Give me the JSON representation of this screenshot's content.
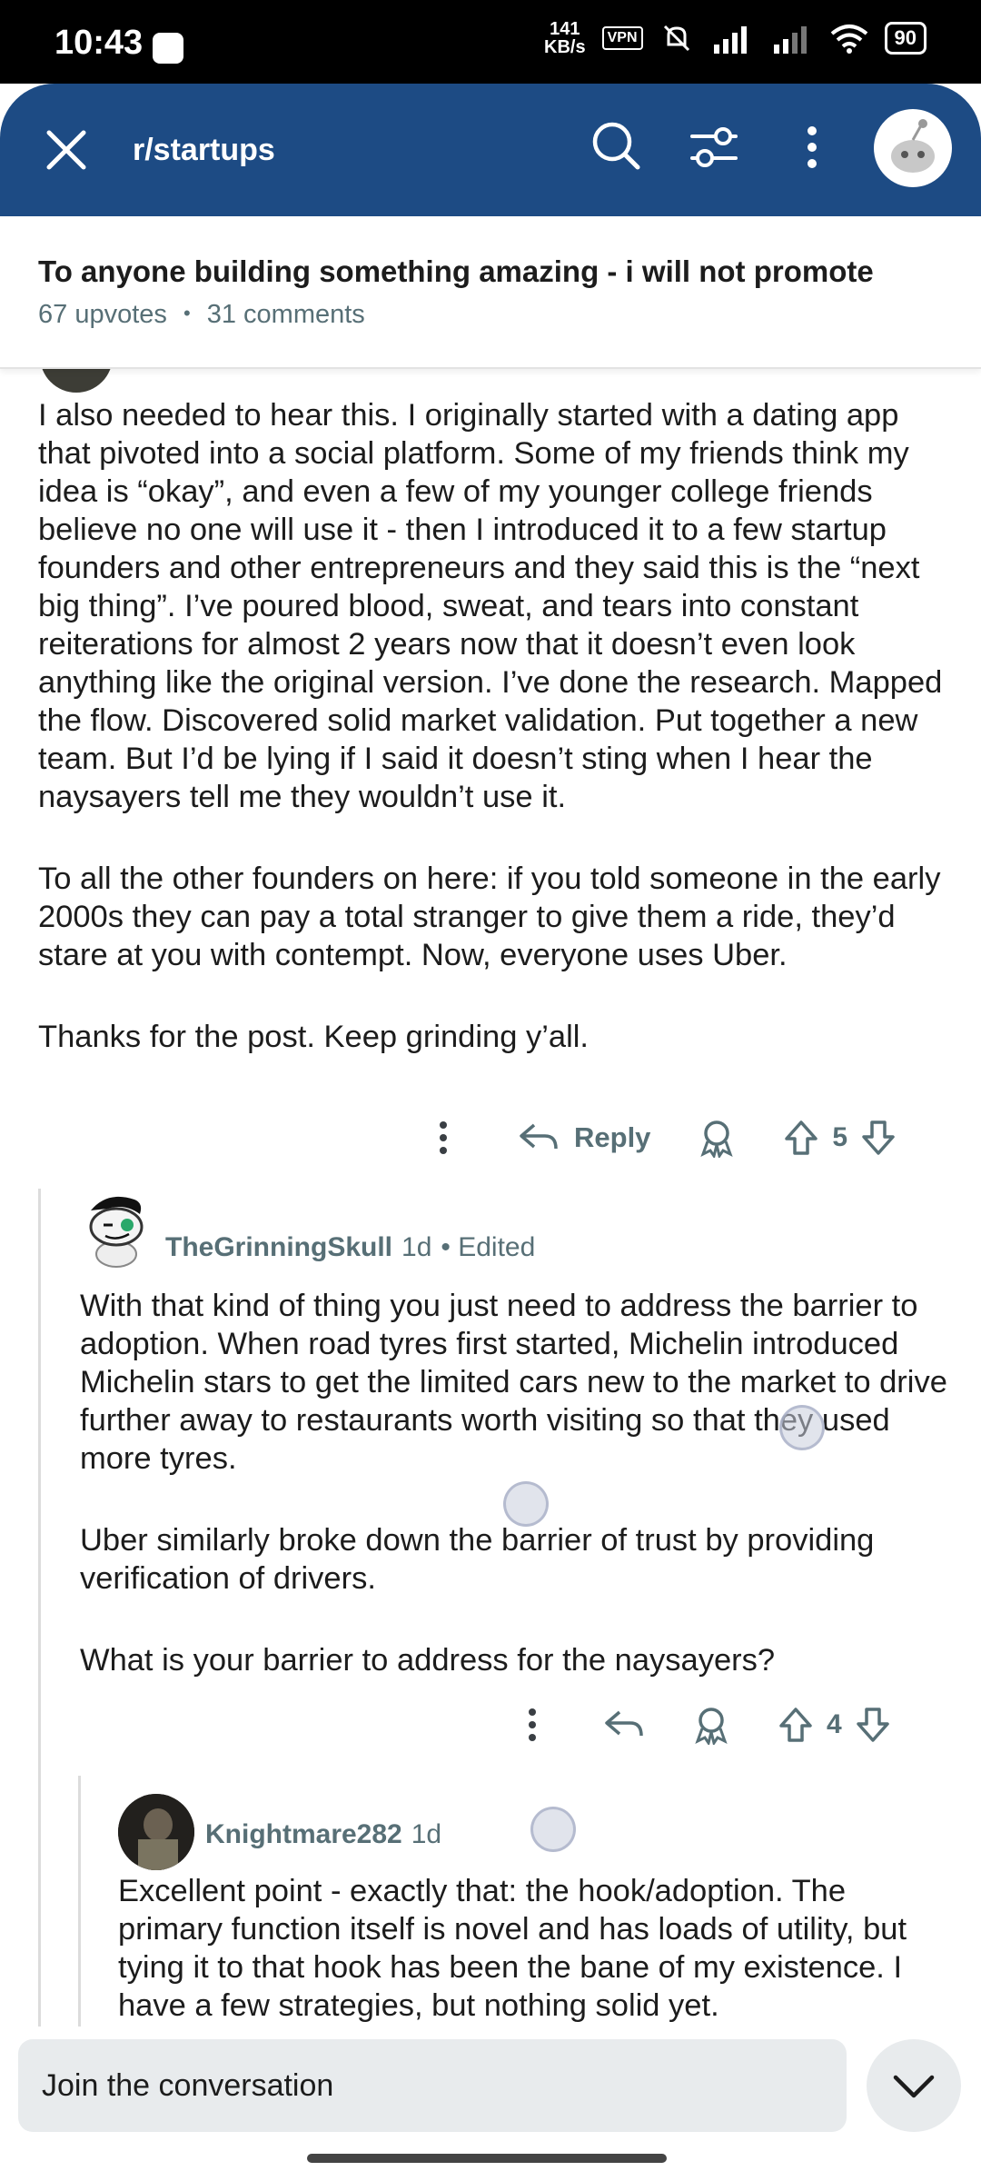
{
  "status_bar": {
    "time": "10:43",
    "net_speed_value": "141",
    "net_speed_unit": "KB/s",
    "vpn": "VPN",
    "battery": "90"
  },
  "top_bar": {
    "subreddit": "r/startups",
    "color": "#1d4b84"
  },
  "post": {
    "title": "To anyone building something amazing - i will not promote",
    "upvotes": "67 upvotes",
    "separator": "•",
    "comments": "31 comments"
  },
  "comments": [
    {
      "paragraphs": [
        "I also needed to hear this. I originally started with a dating app that pivoted into a social platform. Some of my friends think my idea is “okay”, and even a few of my younger college friends believe no one will use it - then I introduced it to a few startup founders and other entrepreneurs and they said this is the “next big thing”. I’ve poured blood, sweat, and tears into constant reiterations for almost 2 years now that it doesn’t even look anything like the original version. I’ve done the research. Mapped the flow. Discovered solid market validation. Put together a new team. But I’d be lying if I said it doesn’t sting when I hear the naysayers tell me they wouldn’t use it.",
        "To all the other founders on here: if you told someone in the early 2000s they can pay a total stranger to give them a ride, they’d stare at you with contempt. Now, everyone uses Uber.",
        "Thanks for the post. Keep grinding y’all."
      ],
      "reply_label": "Reply",
      "votes": "5"
    },
    {
      "username": "TheGrinningSkull",
      "age": "1d",
      "edited": "• Edited",
      "paragraphs": [
        "With that kind of thing you just need to address the barrier to adoption. When road tyres first started, Michelin introduced Michelin stars to get the limited cars new to the market to drive further away to restaurants worth visiting so that they used more tyres.",
        "Uber similarly broke down the barrier of trust by providing verification of drivers.",
        "What is your barrier to address for the naysayers?"
      ],
      "votes": "4"
    },
    {
      "username": "Knightmare282",
      "age": "1d",
      "paragraphs": [
        "Excellent point - exactly that: the hook/adoption. The primary function itself is novel and has loads of utility, but tying it to that hook has been the bane of my existence. I have a few strategies, but nothing solid yet."
      ]
    }
  ],
  "bottom": {
    "placeholder": "Join the conversation"
  }
}
